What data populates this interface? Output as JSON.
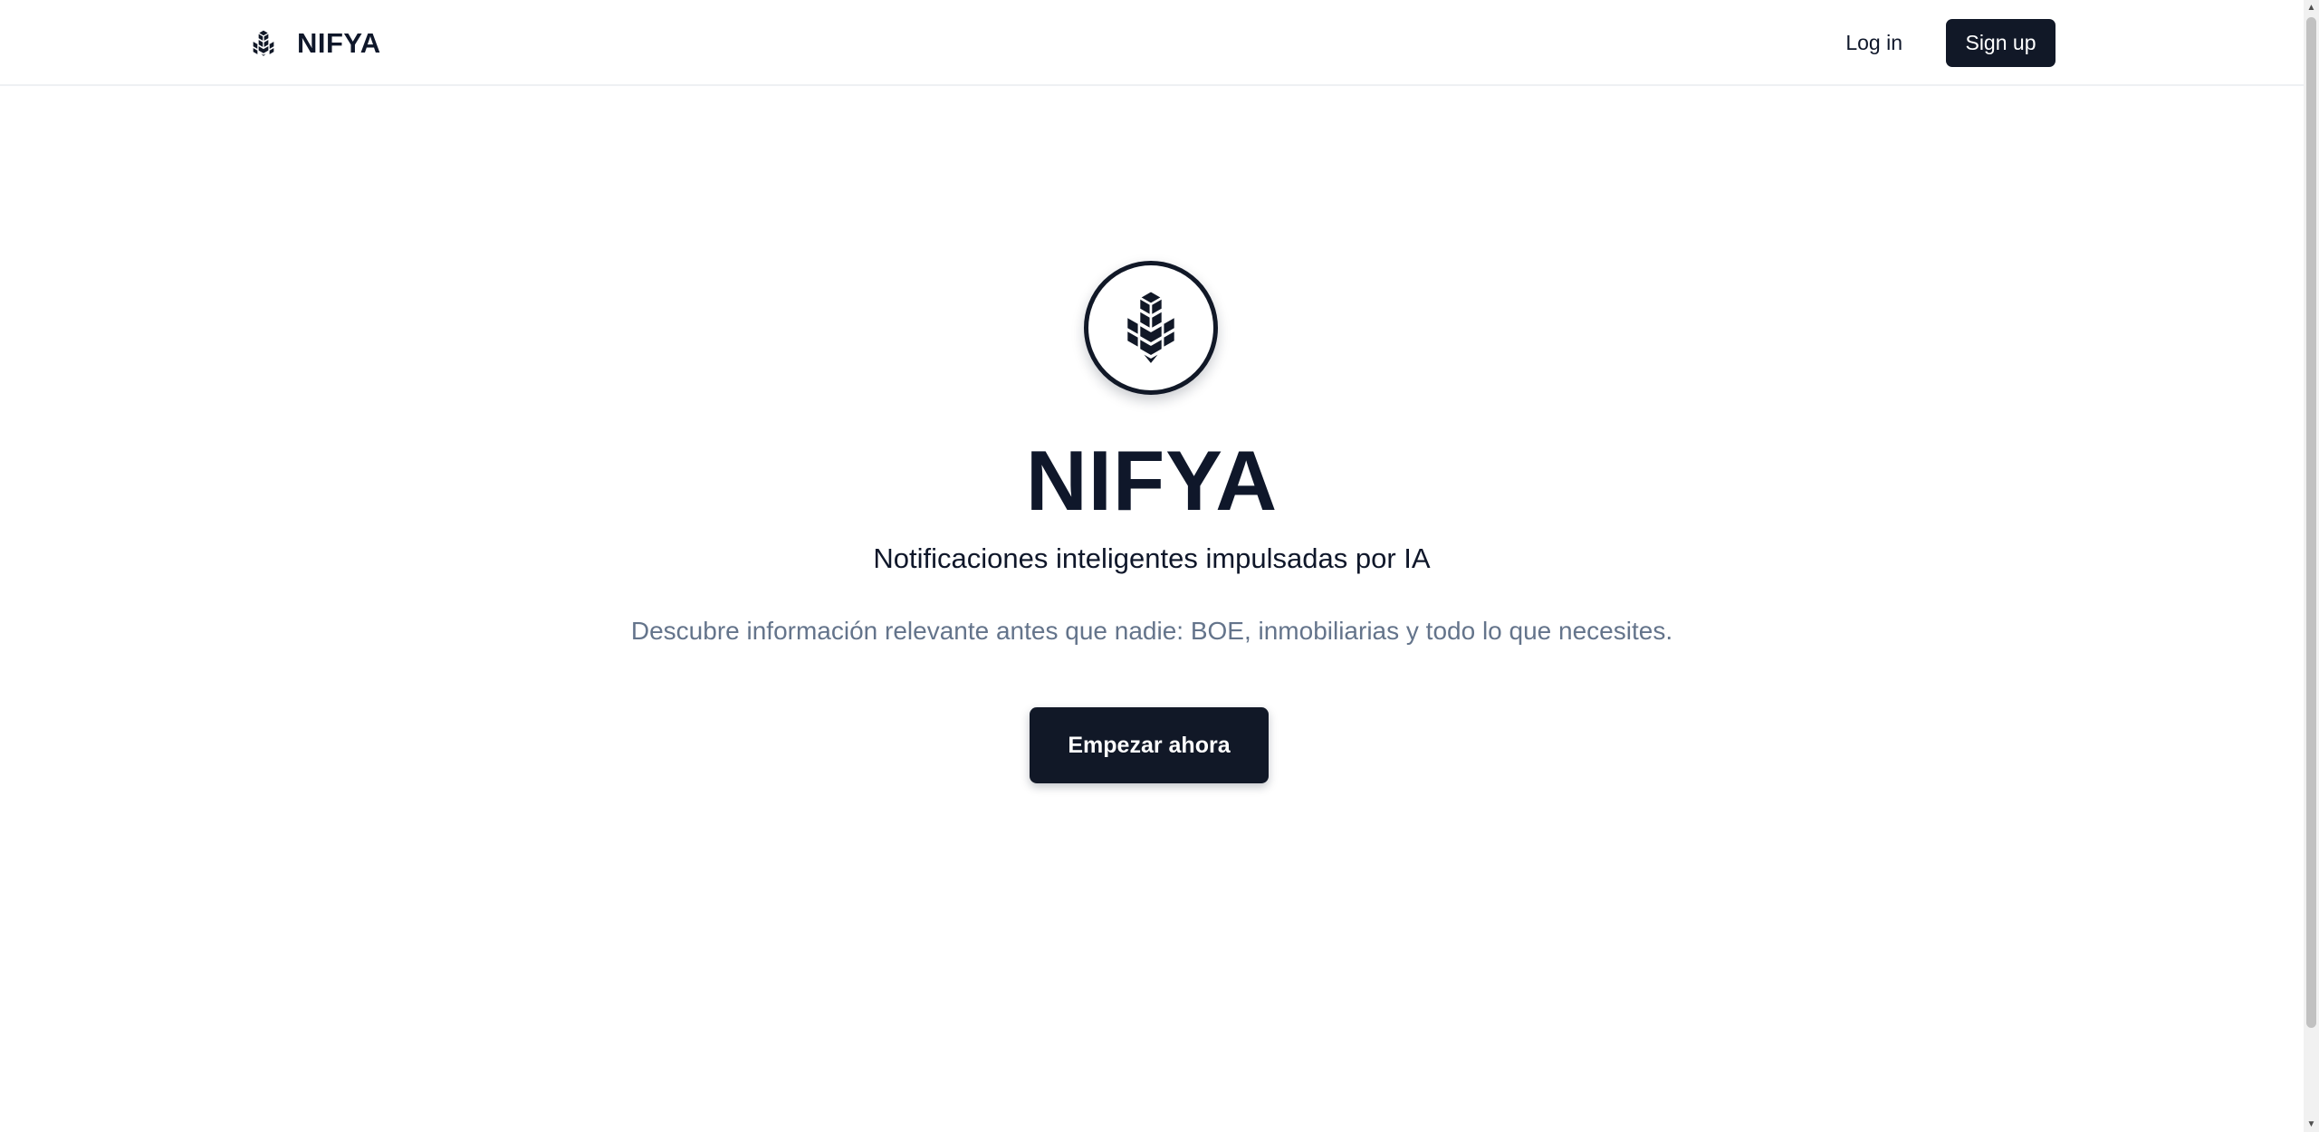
{
  "header": {
    "brand_name": "NIFYA",
    "brand_icon": "nifya-cube-logo-icon",
    "login_label": "Log in",
    "signup_label": "Sign up"
  },
  "hero": {
    "logo_icon": "nifya-cube-logo-icon",
    "title": "NIFYA",
    "subtitle": "Notificaciones inteligentes impulsadas por IA",
    "description": "Descubre información relevante antes que nadie: BOE, inmobiliarias y todo lo que necesites.",
    "cta_label": "Empezar ahora"
  },
  "colors": {
    "primary": "#111827",
    "text": "#0f172a",
    "muted": "#64748b",
    "background": "#ffffff"
  },
  "scrollbar": {
    "up_icon": "scroll-up-arrow-icon",
    "down_icon": "scroll-down-arrow-icon"
  }
}
